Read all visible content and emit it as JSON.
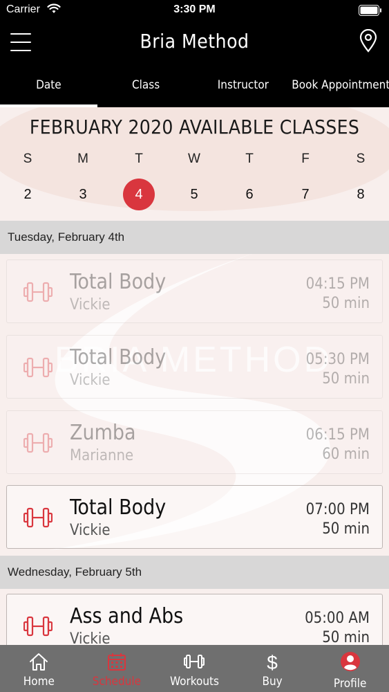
{
  "status_bar": {
    "carrier": "Carrier",
    "time": "3:30 PM"
  },
  "navbar": {
    "title": "Bria Method"
  },
  "tabs": [
    {
      "label": "Date",
      "active": true
    },
    {
      "label": "Class",
      "active": false
    },
    {
      "label": "Instructor",
      "active": false
    },
    {
      "label": "Book Appointment",
      "active": false
    }
  ],
  "calendar": {
    "month_header": "FEBRUARY 2020 AVAILABLE CLASSES",
    "weekdays": [
      "S",
      "M",
      "T",
      "W",
      "T",
      "F",
      "S"
    ],
    "dates": [
      "2",
      "3",
      "4",
      "5",
      "6",
      "7",
      "8"
    ],
    "selected_date": "4"
  },
  "schedule": {
    "days": [
      {
        "header": "Tuesday, February 4th",
        "classes": [
          {
            "name": "Total Body",
            "instructor": "Vickie",
            "time": "04:15 PM",
            "duration": "50 min",
            "available": false
          },
          {
            "name": "Total Body",
            "instructor": "Vickie",
            "time": "05:30 PM",
            "duration": "50 min",
            "available": false
          },
          {
            "name": "Zumba",
            "instructor": "Marianne",
            "time": "06:15 PM",
            "duration": "60 min",
            "available": false
          },
          {
            "name": "Total Body",
            "instructor": "Vickie",
            "time": "07:00 PM",
            "duration": "50 min",
            "available": true
          }
        ]
      },
      {
        "header": "Wednesday, February 5th",
        "classes": [
          {
            "name": "Ass and Abs",
            "instructor": "Vickie",
            "time": "05:00 AM",
            "duration": "50 min",
            "available": true
          }
        ]
      }
    ]
  },
  "background": {
    "watermark_text": "BRIA METHOD"
  },
  "tabbar": {
    "items": [
      {
        "label": "Home",
        "icon": "home-icon",
        "active": false
      },
      {
        "label": "Schedule",
        "icon": "calendar-icon",
        "active": true
      },
      {
        "label": "Workouts",
        "icon": "dumbbell-icon",
        "active": false
      },
      {
        "label": "Buy",
        "icon": "dollar-icon",
        "active": false
      },
      {
        "label": "Profile",
        "icon": "profile-icon",
        "active": false
      }
    ]
  },
  "colors": {
    "accent": "#d9363e",
    "header_bg": "#000000",
    "tabbar_bg": "#6f6f6f"
  }
}
